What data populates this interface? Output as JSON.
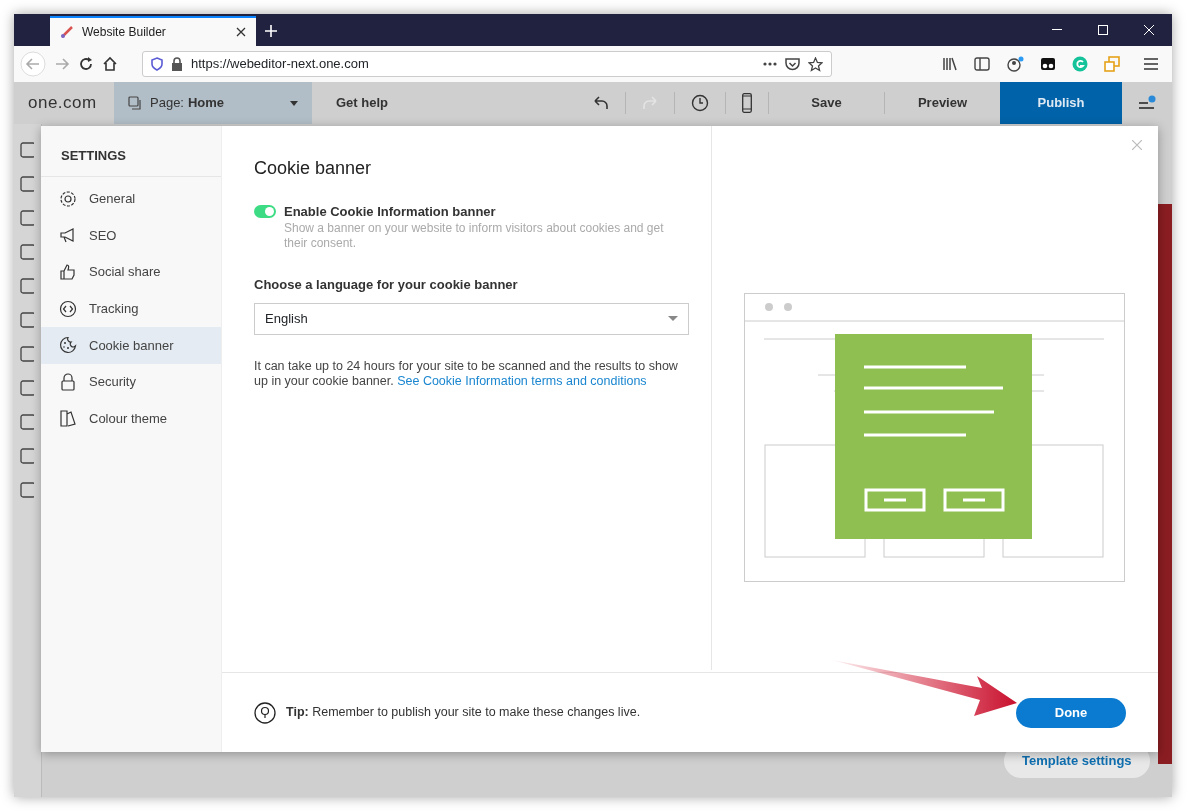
{
  "browser": {
    "tab_title": "Website Builder",
    "url": "https://webeditor-next.one.com"
  },
  "app_bar": {
    "logo": "one.com",
    "page_label": "Page:",
    "page_name": "Home",
    "get_help": "Get help",
    "save": "Save",
    "preview": "Preview",
    "publish": "Publish"
  },
  "settings": {
    "heading": "SETTINGS",
    "items": [
      {
        "kind": "gear",
        "label": "General",
        "selected": false
      },
      {
        "kind": "megaphone",
        "label": "SEO",
        "selected": false
      },
      {
        "kind": "thumb",
        "label": "Social share",
        "selected": false
      },
      {
        "kind": "code",
        "label": "Tracking",
        "selected": false
      },
      {
        "kind": "cookie",
        "label": "Cookie banner",
        "selected": true
      },
      {
        "kind": "lock",
        "label": "Security",
        "selected": false
      },
      {
        "kind": "palette",
        "label": "Colour theme",
        "selected": false
      }
    ]
  },
  "panel": {
    "title": "Cookie banner",
    "toggle": {
      "label": "Enable Cookie Information banner",
      "on": true,
      "description": "Show a banner on your website to inform visitors about cookies and get their consent."
    },
    "language": {
      "label": "Choose a language for your cookie banner",
      "value": "English"
    },
    "note": "It can take up to 24 hours for your site to be scanned and the results to show up in your cookie banner.",
    "note_link": "See Cookie Information terms and conditions"
  },
  "footer": {
    "tip": "**Tip:** Remember to publish your site to make these changes live.",
    "done": "Done"
  },
  "template_settings": "Template settings"
}
